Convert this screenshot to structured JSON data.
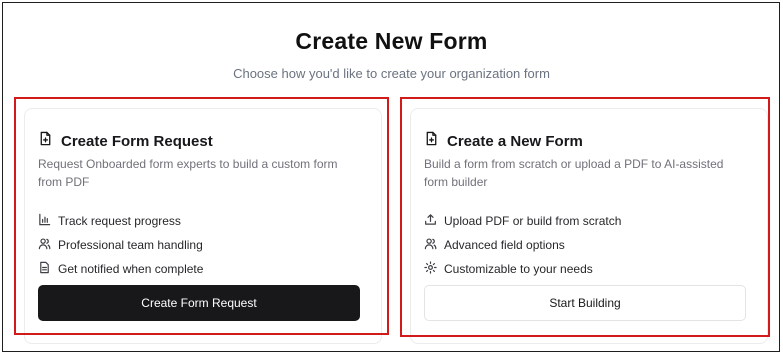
{
  "header": {
    "title": "Create New Form",
    "subtitle": "Choose how you'd like to create your organization form"
  },
  "cards": [
    {
      "title": "Create Form Request",
      "icon": "file-plus-icon",
      "description": "Request Onboarded form experts to build a custom form from PDF",
      "features": [
        {
          "icon": "chart-icon",
          "label": "Track request progress"
        },
        {
          "icon": "users-icon",
          "label": "Professional team handling"
        },
        {
          "icon": "document-icon",
          "label": "Get notified when complete"
        }
      ],
      "button_label": "Create Form Request"
    },
    {
      "title": "Create a New Form",
      "icon": "file-plus-icon",
      "description": "Build a form from scratch or upload a PDF to AI-assisted form builder",
      "features": [
        {
          "icon": "upload-icon",
          "label": "Upload PDF or build from scratch"
        },
        {
          "icon": "users-icon",
          "label": "Advanced field options"
        },
        {
          "icon": "gear-icon",
          "label": "Customizable to your needs"
        }
      ],
      "button_label": "Start Building"
    }
  ],
  "colors": {
    "highlight": "#d11a1a",
    "primary_button": "#18181b",
    "muted_text": "#71717a"
  }
}
